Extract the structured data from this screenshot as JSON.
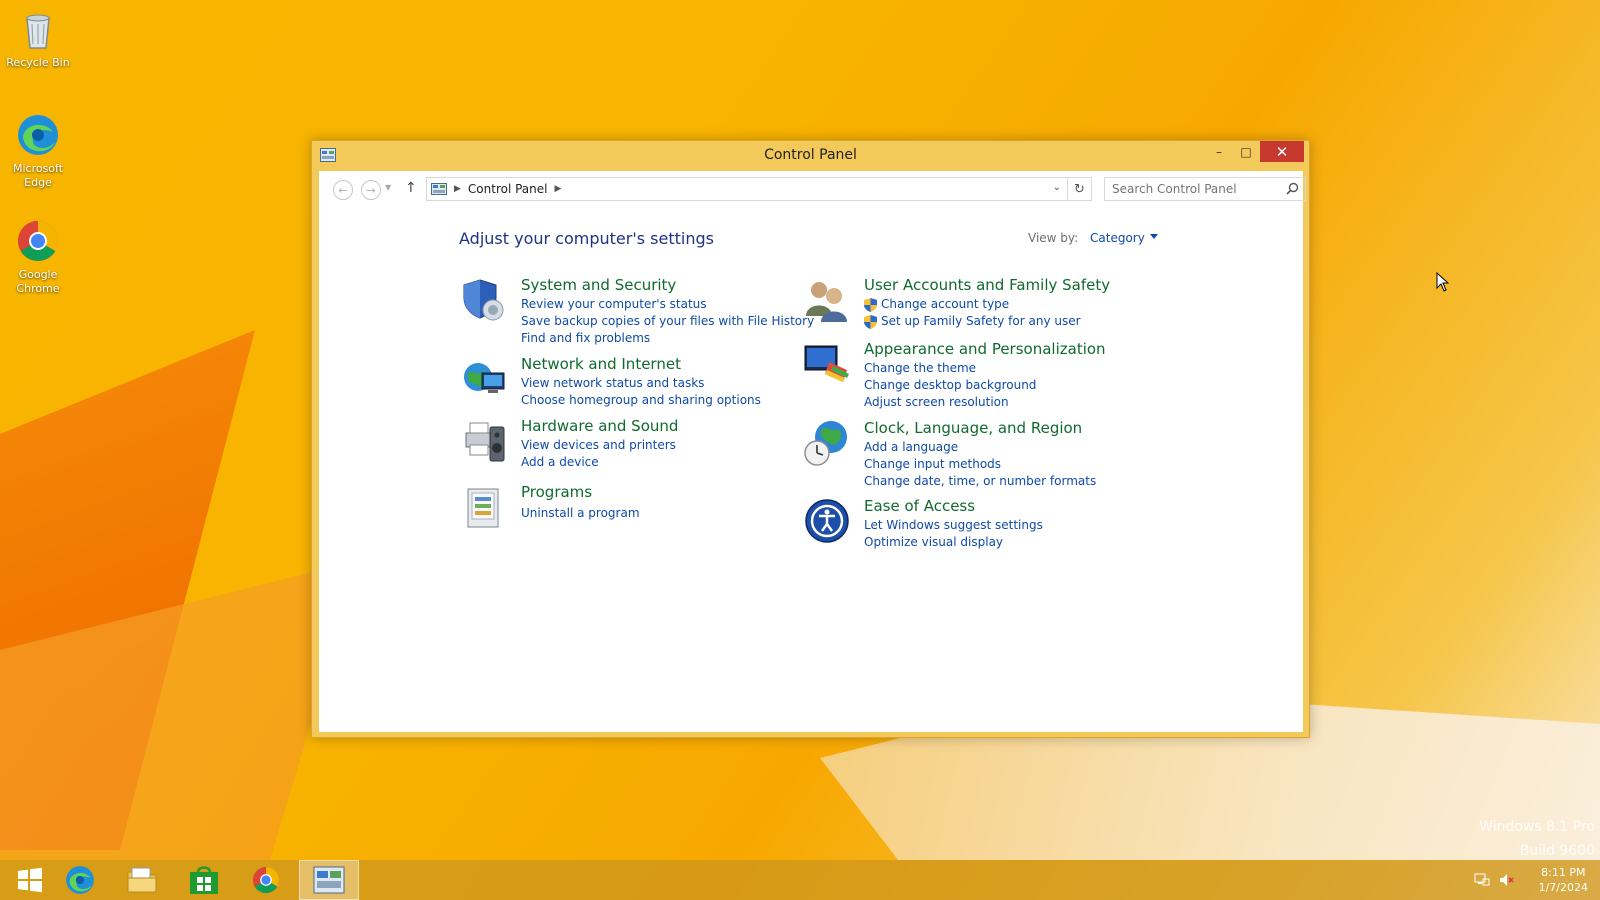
{
  "desktop": {
    "icons": [
      {
        "label_line1": "Recycle Bin",
        "label_line2": "",
        "icon": "recycle-bin-icon"
      },
      {
        "label_line1": "Microsoft",
        "label_line2": "Edge",
        "icon": "edge-icon"
      },
      {
        "label_line1": "Google",
        "label_line2": "Chrome",
        "icon": "chrome-icon"
      }
    ],
    "watermark_line1": "Windows 8.1 Pro",
    "watermark_line2": "Build 9600"
  },
  "window": {
    "title": "Control Panel",
    "buttons": {
      "minimize": "–",
      "maximize": "□",
      "close": "✕"
    }
  },
  "nav": {
    "breadcrumb": [
      "Control Panel"
    ],
    "search_placeholder": "Search Control Panel"
  },
  "main": {
    "heading": "Adjust your computer's settings",
    "view_by_label": "View by:",
    "view_by_value": "Category",
    "categories_left": [
      {
        "title": "System and Security",
        "icon": "shield-security-icon",
        "links": [
          "Review your computer's status",
          "Save backup copies of your files with File History",
          "Find and fix problems"
        ]
      },
      {
        "title": "Network and Internet",
        "icon": "network-globe-icon",
        "links": [
          "View network status and tasks",
          "Choose homegroup and sharing options"
        ]
      },
      {
        "title": "Hardware and Sound",
        "icon": "printer-speaker-icon",
        "links": [
          "View devices and printers",
          "Add a device"
        ]
      },
      {
        "title": "Programs",
        "icon": "programs-icon",
        "links": [
          "Uninstall a program"
        ]
      }
    ],
    "categories_right": [
      {
        "title": "User Accounts and Family Safety",
        "icon": "users-icon",
        "links": [
          "Change account type",
          "Set up Family Safety for any user"
        ]
      },
      {
        "title": "Appearance and Personalization",
        "icon": "monitor-palette-icon",
        "links": [
          "Change the theme",
          "Change desktop background",
          "Adjust screen resolution"
        ]
      },
      {
        "title": "Clock, Language, and Region",
        "icon": "clock-globe-icon",
        "links": [
          "Add a language",
          "Change input methods",
          "Change date, time, or number formats"
        ]
      },
      {
        "title": "Ease of Access",
        "icon": "ease-of-access-icon",
        "links": [
          "Let Windows suggest settings",
          "Optimize visual display"
        ]
      }
    ]
  },
  "taskbar": {
    "items": [
      "start-icon",
      "edge-icon",
      "file-explorer-icon",
      "store-icon",
      "chrome-icon",
      "control-panel-icon"
    ],
    "time": "8:11 PM",
    "date": "1/7/2024"
  },
  "colors": {
    "category_title": "#0f6a2d",
    "link": "#0f4aa7",
    "heading": "#1e3287",
    "close_button": "#c7392f",
    "desktop": "#f7b500"
  }
}
